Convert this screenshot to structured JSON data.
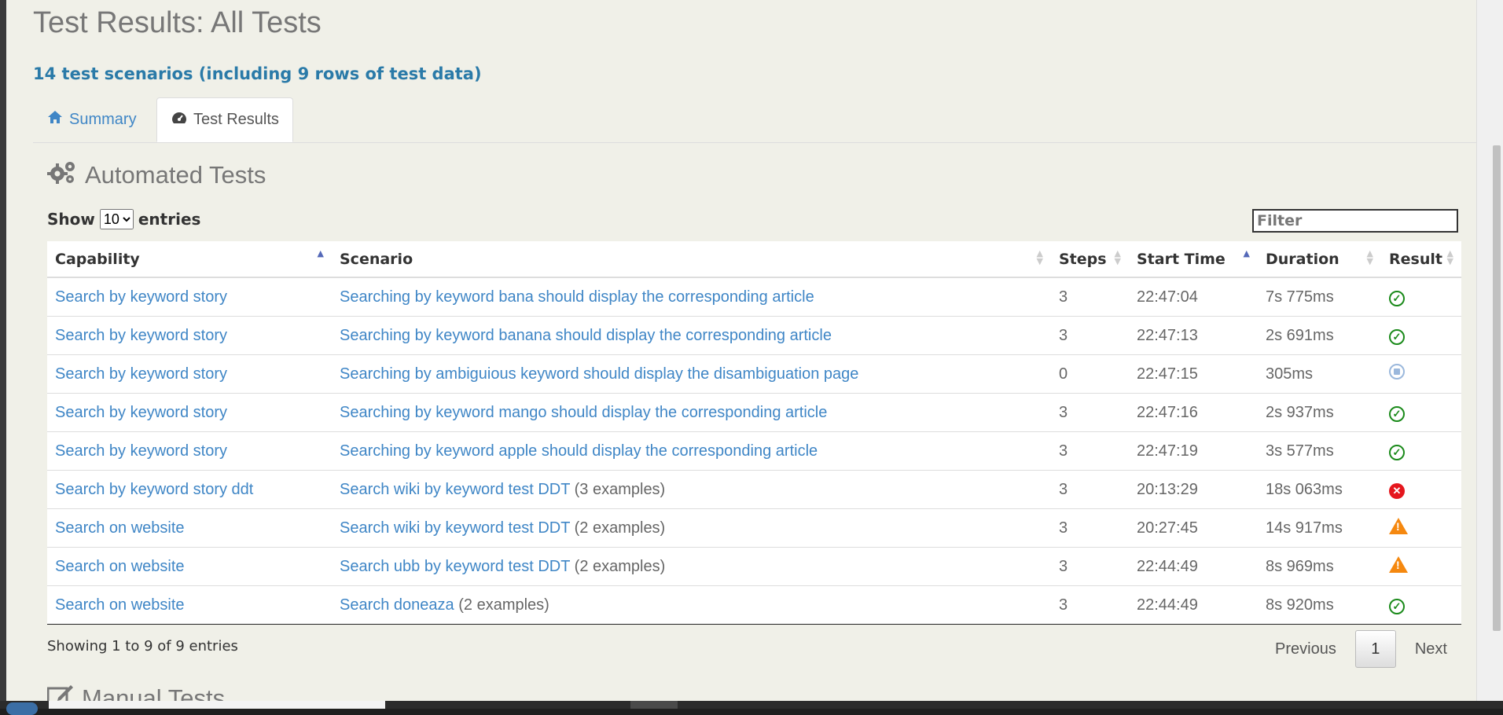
{
  "page": {
    "title": "Test Results: All Tests",
    "summary_line": "14 test scenarios (including 9 rows of test data)"
  },
  "tabs": [
    {
      "label": "Summary",
      "icon": "home-icon",
      "active": false
    },
    {
      "label": "Test Results",
      "icon": "dashboard-icon",
      "active": true
    }
  ],
  "automated": {
    "heading": "Automated Tests",
    "icon": "gears-icon",
    "show_label": "Show",
    "entries_label": "entries",
    "page_size": "10",
    "page_size_options": [
      "10"
    ],
    "filter_placeholder": "Filter"
  },
  "table": {
    "columns": [
      "Capability",
      "Scenario",
      "Steps",
      "Start Time",
      "Duration",
      "Result"
    ],
    "rows": [
      {
        "capability": "Search by keyword story",
        "scenario": "Searching by keyword bana should display the corresponding article",
        "examples": "",
        "steps": "3",
        "start": "22:47:04",
        "duration": "7s 775ms",
        "result": "pass"
      },
      {
        "capability": "Search by keyword story",
        "scenario": "Searching by keyword banana should display the corresponding article",
        "examples": "",
        "steps": "3",
        "start": "22:47:13",
        "duration": "2s 691ms",
        "result": "pass"
      },
      {
        "capability": "Search by keyword story",
        "scenario": "Searching by ambiguious keyword should display the disambiguation page",
        "examples": "",
        "steps": "0",
        "start": "22:47:15",
        "duration": "305ms",
        "result": "pending"
      },
      {
        "capability": "Search by keyword story",
        "scenario": "Searching by keyword mango should display the corresponding article",
        "examples": "",
        "steps": "3",
        "start": "22:47:16",
        "duration": "2s 937ms",
        "result": "pass"
      },
      {
        "capability": "Search by keyword story",
        "scenario": "Searching by keyword apple should display the corresponding article",
        "examples": "",
        "steps": "3",
        "start": "22:47:19",
        "duration": "3s 577ms",
        "result": "pass"
      },
      {
        "capability": "Search by keyword story ddt",
        "scenario": "Search wiki by keyword test DDT",
        "examples": "(3 examples)",
        "steps": "3",
        "start": "20:13:29",
        "duration": "18s 063ms",
        "result": "fail"
      },
      {
        "capability": "Search on website",
        "scenario": "Search wiki by keyword test DDT",
        "examples": "(2 examples)",
        "steps": "3",
        "start": "20:27:45",
        "duration": "14s 917ms",
        "result": "warn"
      },
      {
        "capability": "Search on website",
        "scenario": "Search ubb by keyword test DDT",
        "examples": "(2 examples)",
        "steps": "3",
        "start": "22:44:49",
        "duration": "8s 969ms",
        "result": "warn"
      },
      {
        "capability": "Search on website",
        "scenario": "Search doneaza",
        "examples": "(2 examples)",
        "steps": "3",
        "start": "22:44:49",
        "duration": "8s 920ms",
        "result": "pass"
      }
    ]
  },
  "footer": {
    "info": "Showing 1 to 9 of 9 entries",
    "previous": "Previous",
    "current_page": "1",
    "next": "Next"
  },
  "manual": {
    "heading": "Manual Tests",
    "icon": "edit-icon"
  },
  "colors": {
    "link": "#3f86c6",
    "subtitle": "#2a7aa8",
    "pass": "#1a8a1a",
    "fail": "#e5161d",
    "warn": "#f5880f",
    "pending": "#9bb8dc"
  }
}
